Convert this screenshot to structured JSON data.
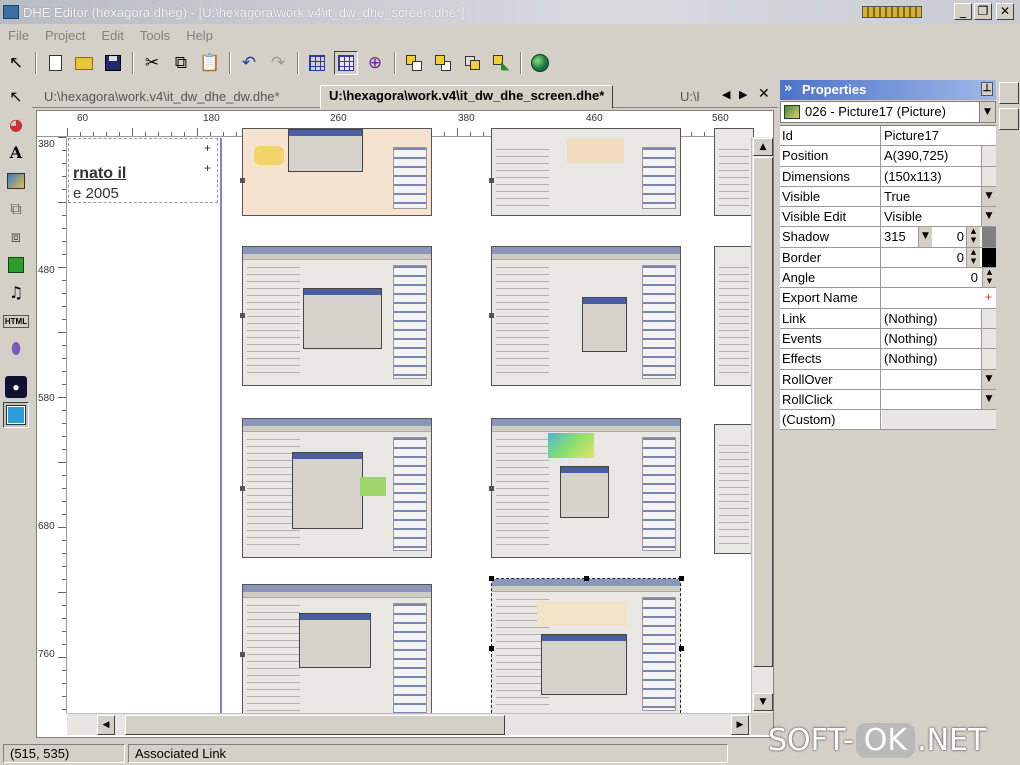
{
  "window": {
    "title": "DHE Editor (hexagora.dheg) - [U:\\hexagora\\work.v4\\it_dw_dhe_screen.dhe*]"
  },
  "menu": [
    "File",
    "Project",
    "Edit",
    "Tools",
    "Help"
  ],
  "toolbar_icons": [
    "arrow-pointer",
    "new-document",
    "open-folder",
    "save-disk",
    "cut-scissors",
    "copy",
    "paste",
    "undo",
    "redo",
    "grid",
    "snap-grid",
    "zoom",
    "bring-front",
    "send-back",
    "bring-forward",
    "send-backward",
    "preview-globe"
  ],
  "tabs": [
    {
      "label": "U:\\hexagora\\work.v4\\it_dw_dhe_dw.dhe*"
    },
    {
      "label": "U:\\hexagora\\work.v4\\it_dw_dhe_screen.dhe*"
    },
    {
      "label": "U:\\l"
    }
  ],
  "ruler": {
    "horizontal": [
      "60",
      "180",
      "260",
      "380",
      "460",
      "560"
    ],
    "vertical": [
      "380",
      "480",
      "580",
      "680",
      "760"
    ]
  },
  "canvas": {
    "text_line1": "rnato il",
    "text_line2": "e 2005"
  },
  "properties": {
    "header": "Properties",
    "selected_object": "026 - Picture17 (Picture)",
    "rows": [
      {
        "name": "Id",
        "value": "Picture17"
      },
      {
        "name": "Position",
        "value": "A(390,725)"
      },
      {
        "name": "Dimensions",
        "value": "(150x113)"
      },
      {
        "name": "Visible",
        "value": "True"
      },
      {
        "name": "Visible Edit",
        "value": "Visible"
      },
      {
        "name": "Shadow",
        "value": "315",
        "value2": "0"
      },
      {
        "name": "Border",
        "value": "0"
      },
      {
        "name": "Angle",
        "value": "0"
      },
      {
        "name": "Export Name",
        "value": ""
      },
      {
        "name": "Link",
        "value": "(Nothing)"
      },
      {
        "name": "Events",
        "value": "(Nothing)"
      },
      {
        "name": "Effects",
        "value": "(Nothing)"
      },
      {
        "name": "RollOver",
        "value": ""
      },
      {
        "name": "RollClick",
        "value": ""
      },
      {
        "name": "(Custom)",
        "value": ""
      }
    ]
  },
  "status": {
    "coords": "(515, 535)",
    "message": "Associated Link"
  },
  "watermark": {
    "left": "SOFT-",
    "pill": "OK",
    "right": ".NET"
  },
  "colors": {
    "title_gradient": "#4a72c8",
    "selection": "#000000",
    "page_edge": "#7b86c8"
  }
}
